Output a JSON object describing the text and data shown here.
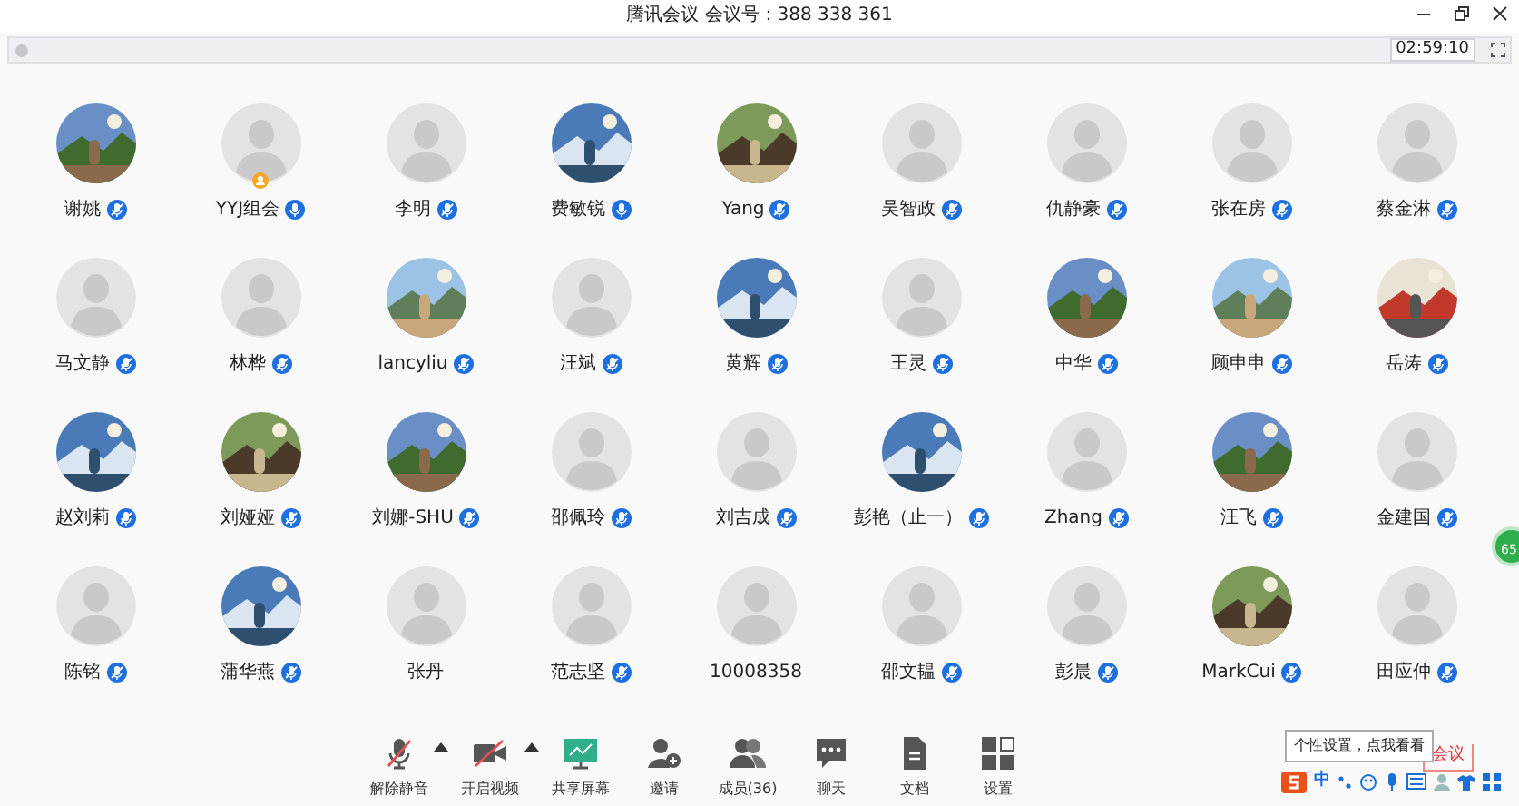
{
  "window": {
    "title": "腾讯会议 会议号：388 338 361"
  },
  "timer": "02:59:10",
  "participants": [
    {
      "name": "谢姚",
      "mic": true,
      "muted": true,
      "host": false
    },
    {
      "name": "YYJ组会",
      "kind": "default",
      "mic": true,
      "muted": false,
      "host": true
    },
    {
      "name": "李明",
      "kind": "default",
      "mic": true,
      "muted": true,
      "host": false
    },
    {
      "name": "费敏锐",
      "mic": true,
      "muted": false,
      "host": false
    },
    {
      "name": "Yang",
      "mic": true,
      "muted": true,
      "host": false
    },
    {
      "name": "吴智政",
      "kind": "default",
      "mic": true,
      "muted": true,
      "host": false
    },
    {
      "name": "仇静豪",
      "kind": "default",
      "mic": true,
      "muted": true,
      "host": false
    },
    {
      "name": "张在房",
      "kind": "default",
      "mic": true,
      "muted": true,
      "host": false
    },
    {
      "name": "蔡金淋",
      "kind": "default",
      "mic": true,
      "muted": true,
      "host": false
    },
    {
      "name": "马文静",
      "kind": "default",
      "mic": true,
      "muted": true,
      "host": false
    },
    {
      "name": "林桦",
      "kind": "default",
      "mic": true,
      "muted": true,
      "host": false
    },
    {
      "name": "lancyliu",
      "mic": true,
      "muted": true,
      "host": false
    },
    {
      "name": "汪斌",
      "kind": "default",
      "mic": true,
      "muted": true,
      "host": false
    },
    {
      "name": "黄辉",
      "mic": true,
      "muted": true,
      "host": false
    },
    {
      "name": "王灵",
      "kind": "default",
      "mic": true,
      "muted": true,
      "host": false
    },
    {
      "name": "中华",
      "mic": true,
      "muted": true,
      "host": false
    },
    {
      "name": "顾申申",
      "mic": true,
      "muted": true,
      "host": false
    },
    {
      "name": "岳涛",
      "mic": true,
      "muted": true,
      "host": false
    },
    {
      "name": "赵刘莉",
      "mic": true,
      "muted": true,
      "host": false
    },
    {
      "name": "刘娅娅",
      "mic": true,
      "muted": true,
      "host": false
    },
    {
      "name": "刘娜-SHU",
      "mic": true,
      "muted": true,
      "host": false
    },
    {
      "name": "邵佩玲",
      "kind": "default",
      "mic": true,
      "muted": true,
      "host": false
    },
    {
      "name": "刘吉成",
      "kind": "default",
      "mic": true,
      "muted": true,
      "host": false
    },
    {
      "name": "彭艳（止一）",
      "mic": true,
      "muted": true,
      "host": false
    },
    {
      "name": "Zhang",
      "kind": "default",
      "mic": true,
      "muted": true,
      "host": false
    },
    {
      "name": "汪飞",
      "mic": true,
      "muted": true,
      "host": false
    },
    {
      "name": "金建国",
      "kind": "default",
      "mic": true,
      "muted": true,
      "host": false
    },
    {
      "name": "陈铭",
      "kind": "default",
      "mic": true,
      "muted": true,
      "host": false
    },
    {
      "name": "蒲华燕",
      "mic": true,
      "muted": true,
      "host": false
    },
    {
      "name": "张丹",
      "kind": "default",
      "mic": false,
      "host": false
    },
    {
      "name": "范志坚",
      "kind": "default",
      "mic": true,
      "muted": true,
      "host": false
    },
    {
      "name": "10008358",
      "kind": "default",
      "mic": false,
      "host": false
    },
    {
      "name": "邵文韫",
      "kind": "default",
      "mic": true,
      "muted": true,
      "host": false
    },
    {
      "name": "彭晨",
      "kind": "default",
      "mic": true,
      "muted": true,
      "host": false
    },
    {
      "name": "MarkCui",
      "mic": true,
      "muted": true,
      "host": false
    },
    {
      "name": "田应仲",
      "kind": "default",
      "mic": true,
      "muted": true,
      "host": false
    }
  ],
  "toolbar": [
    {
      "label": "解除静音",
      "kind": "mic",
      "dropdown": true
    },
    {
      "label": "开启视频",
      "kind": "video",
      "dropdown": true
    },
    {
      "label": "共享屏幕",
      "kind": "share",
      "dropdown": false
    },
    {
      "label": "邀请",
      "kind": "invite",
      "dropdown": false
    },
    {
      "label": "成员(36)",
      "kind": "members",
      "dropdown": false
    },
    {
      "label": "聊天",
      "kind": "chat",
      "dropdown": false
    },
    {
      "label": "文档",
      "kind": "docs",
      "dropdown": false
    },
    {
      "label": "设置",
      "kind": "settings",
      "dropdown": false
    }
  ],
  "ime": {
    "tooltip": "个性设置，点我看看",
    "behind_text": "会议",
    "mode": "中"
  },
  "side_badge": "65"
}
